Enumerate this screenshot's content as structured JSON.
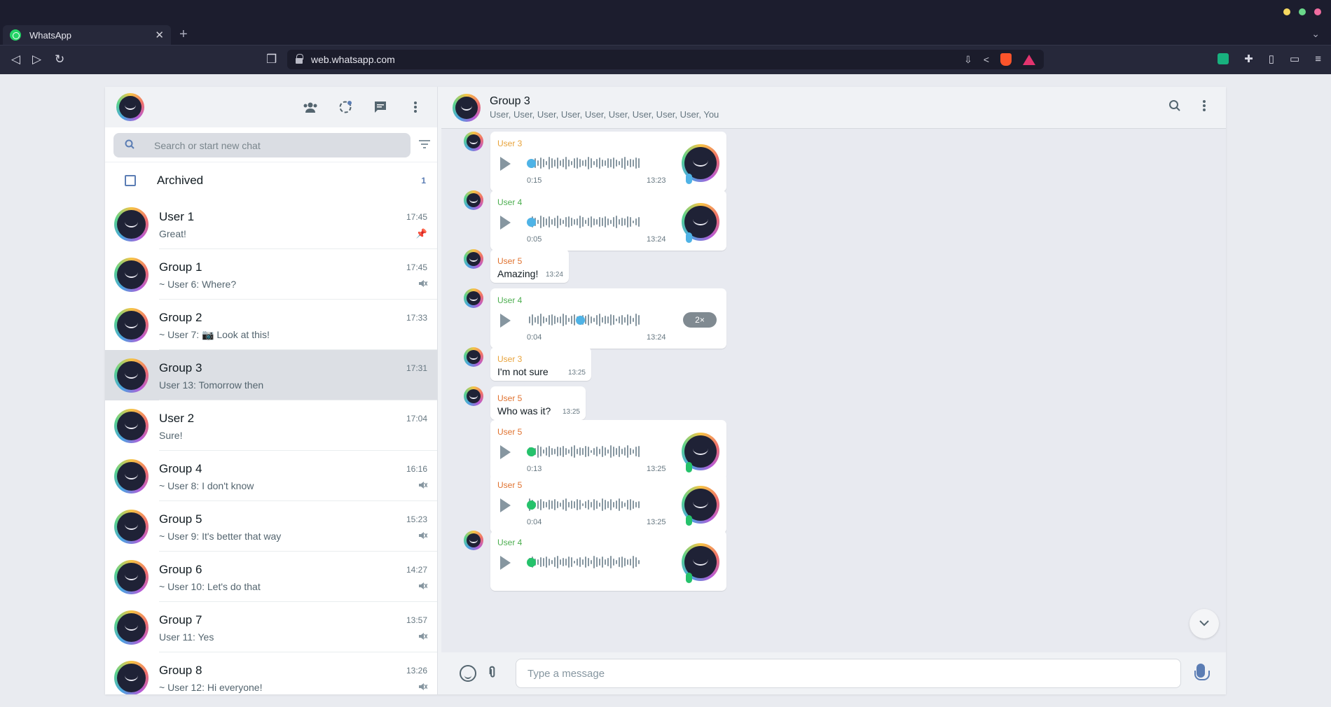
{
  "browser": {
    "tab_title": "WhatsApp",
    "tab_close": "✕",
    "new_tab": "+",
    "tab_menu": "⌄",
    "url": "web.whatsapp.com",
    "back": "◁",
    "forward": "▷",
    "reload": "↻",
    "bookmark": "❒",
    "url_icons": {
      "download": "⇩",
      "share": "<"
    },
    "ext_icons": {
      "puzzle": "✚",
      "sidebar": "▯",
      "wallet": "▭",
      "menu": "≡"
    },
    "window_dot_colors": [
      "#f6d860",
      "#6ad88a",
      "#f06ca0"
    ]
  },
  "sidebar": {
    "header_icons": [
      "community-icon",
      "status-icon",
      "new-chat-icon",
      "menu-icon"
    ],
    "search_placeholder": "Search or start new chat",
    "archived": {
      "label": "Archived",
      "count": "1"
    },
    "chats": [
      {
        "name": "User 1",
        "preview": "Great!",
        "time": "17:45",
        "badge": "pin"
      },
      {
        "name": "Group 1",
        "preview": "~ User 6: Where?",
        "time": "17:45",
        "badge": "muted"
      },
      {
        "name": "Group 2",
        "preview": "~ User 7: 📷 Look at this!",
        "time": "17:33",
        "badge": ""
      },
      {
        "name": "Group 3",
        "preview": "User 13: Tomorrow then",
        "time": "17:31",
        "badge": "",
        "active": true
      },
      {
        "name": "User 2",
        "preview": "Sure!",
        "time": "17:04",
        "badge": ""
      },
      {
        "name": "Group 4",
        "preview": "~ User 8: I don't know",
        "time": "16:16",
        "badge": "muted"
      },
      {
        "name": "Group 5",
        "preview": "~ User 9: It's better that way",
        "time": "15:23",
        "badge": "muted"
      },
      {
        "name": "Group 6",
        "preview": "~ User 10: Let's do that",
        "time": "14:27",
        "badge": "muted"
      },
      {
        "name": "Group 7",
        "preview": "User 11: Yes",
        "time": "13:57",
        "badge": "muted"
      },
      {
        "name": "Group 8",
        "preview": "~ User 12: Hi everyone!",
        "time": "13:26",
        "badge": "muted"
      }
    ]
  },
  "conversation": {
    "title": "Group 3",
    "members": "User, User, User, User, User, User, User, User, User, You",
    "messages": [
      {
        "type": "voice",
        "sender": "User 3",
        "sender_color": "#e8a33a",
        "duration": "0:15",
        "time": "13:23",
        "progress_color": "#4fb3e6",
        "progress": 0.0,
        "avatar_tail": true
      },
      {
        "type": "voice",
        "sender": "User 4",
        "sender_color": "#4cae4f",
        "duration": "0:05",
        "time": "13:24",
        "progress_color": "#4fb3e6",
        "progress": 0.0,
        "avatar_tail": true
      },
      {
        "type": "text",
        "sender": "User 5",
        "sender_color": "#e0722f",
        "text": "Amazing!",
        "time": "13:24",
        "avatar_tail": true
      },
      {
        "type": "voice",
        "sender": "User 4",
        "sender_color": "#4cae4f",
        "duration": "0:04",
        "time": "13:24",
        "progress_color": "#4fb3e6",
        "progress": 0.4,
        "speed": "2×",
        "avatar_tail": true
      },
      {
        "type": "text",
        "sender": "User 3",
        "sender_color": "#e8a33a",
        "text": "I'm not sure",
        "time": "13:25",
        "avatar_tail": true
      },
      {
        "type": "text",
        "sender": "User 5",
        "sender_color": "#e0722f",
        "text": "Who was it?",
        "time": "13:25",
        "avatar_tail": true
      },
      {
        "type": "voice",
        "sender": "User 5",
        "sender_color": "#e0722f",
        "duration": "0:13",
        "time": "13:25",
        "progress_color": "#25c26b",
        "progress": 0.0,
        "avatar_tail": false
      },
      {
        "type": "voice",
        "sender": "User 5",
        "sender_color": "#e0722f",
        "duration": "0:04",
        "time": "13:25",
        "progress_color": "#25c26b",
        "progress": 0.0,
        "avatar_tail": false
      },
      {
        "type": "voice",
        "sender": "User 4",
        "sender_color": "#4cae4f",
        "duration": "",
        "time": "",
        "progress_color": "#25c26b",
        "progress": 0.0,
        "avatar_tail": true
      }
    ],
    "input_placeholder": "Type a message"
  }
}
